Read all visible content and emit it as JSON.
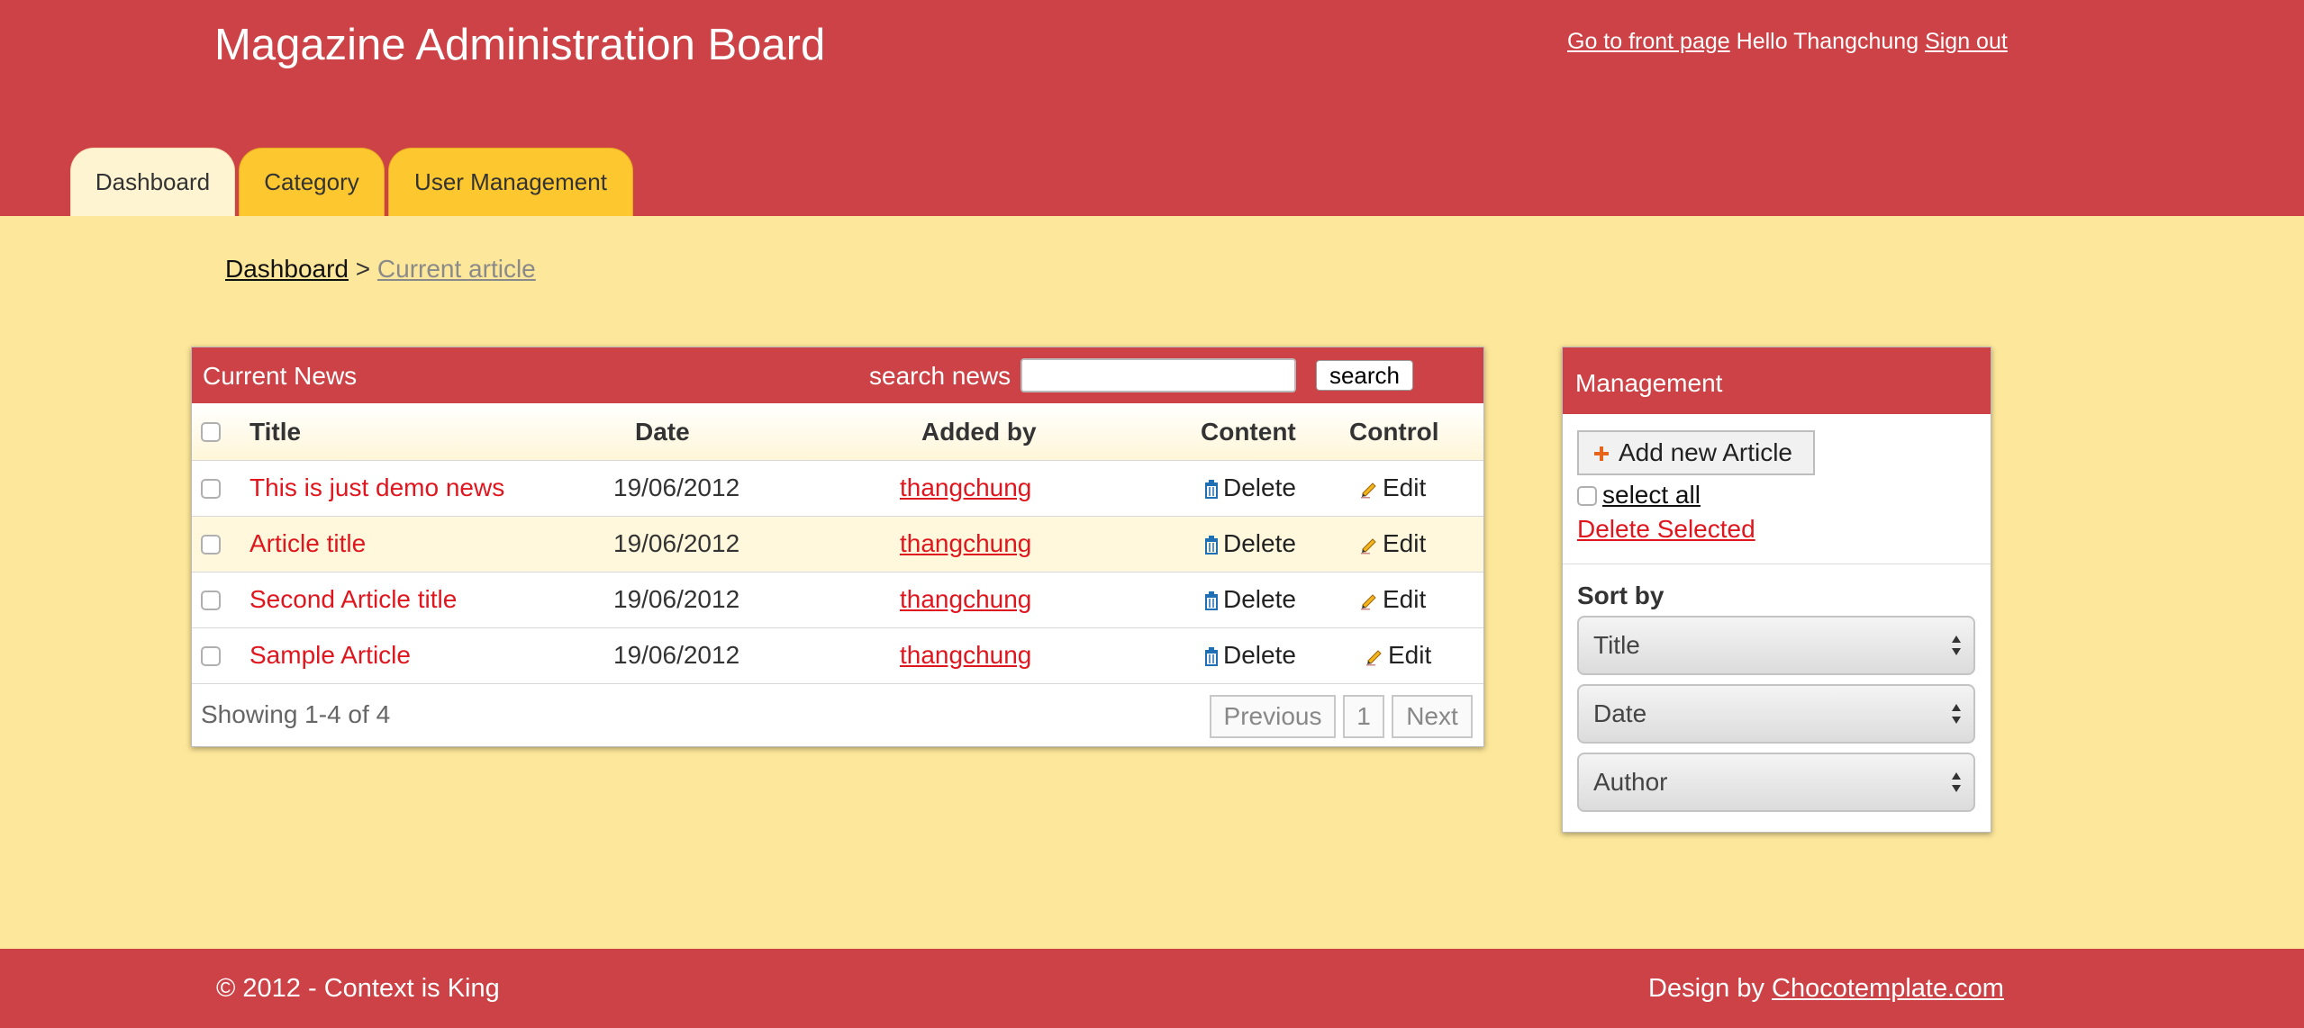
{
  "header": {
    "site_title": "Magazine Administration Board",
    "front_page_link": "Go to front page",
    "greeting": "Hello Thangchung",
    "sign_out": "Sign out"
  },
  "tabs": [
    {
      "label": "Dashboard",
      "active": true
    },
    {
      "label": "Category",
      "active": false
    },
    {
      "label": "User Management",
      "active": false
    }
  ],
  "breadcrumb": {
    "home": "Dashboard",
    "separator": ">",
    "current": "Current article"
  },
  "news_panel": {
    "title": "Current News",
    "search_label": "search news",
    "search_value": "",
    "search_button": "search",
    "columns": [
      "Title",
      "Date",
      "Added by",
      "Content",
      "Control"
    ],
    "rows": [
      {
        "title": "This is just demo news",
        "date": "19/06/2012",
        "added_by": "thangchung",
        "content_action": "Delete",
        "control_action": "Edit"
      },
      {
        "title": "Article title",
        "date": "19/06/2012",
        "added_by": "thangchung",
        "content_action": "Delete",
        "control_action": "Edit"
      },
      {
        "title": "Second Article title",
        "date": "19/06/2012",
        "added_by": "thangchung",
        "content_action": "Delete",
        "control_action": "Edit"
      },
      {
        "title": "Sample Article",
        "date": "19/06/2012",
        "added_by": "thangchung",
        "content_action": "Delete",
        "control_action": "Edit"
      }
    ],
    "showing": "Showing 1-4 of 4",
    "pager": {
      "previous": "Previous",
      "page": "1",
      "next": "Next"
    }
  },
  "management": {
    "title": "Management",
    "add_button": "Add new Article",
    "select_all": "select all",
    "delete_selected": "Delete Selected",
    "sort_by_label": "Sort by",
    "sort_selects": [
      "Title",
      "Date",
      "Author"
    ]
  },
  "footer": {
    "copyright": "© 2012 - Context is King",
    "design_by": "Design by",
    "design_link": "Chocotemplate.com"
  },
  "icons": {
    "delete": "trash-icon",
    "edit": "pencil-icon",
    "add": "plus-icon",
    "select": "sort-arrows-icon"
  },
  "colors": {
    "brand_red": "#cc4246",
    "background": "#fde79a",
    "tab_yellow": "#fdc82f",
    "link_red": "#e0161e"
  }
}
